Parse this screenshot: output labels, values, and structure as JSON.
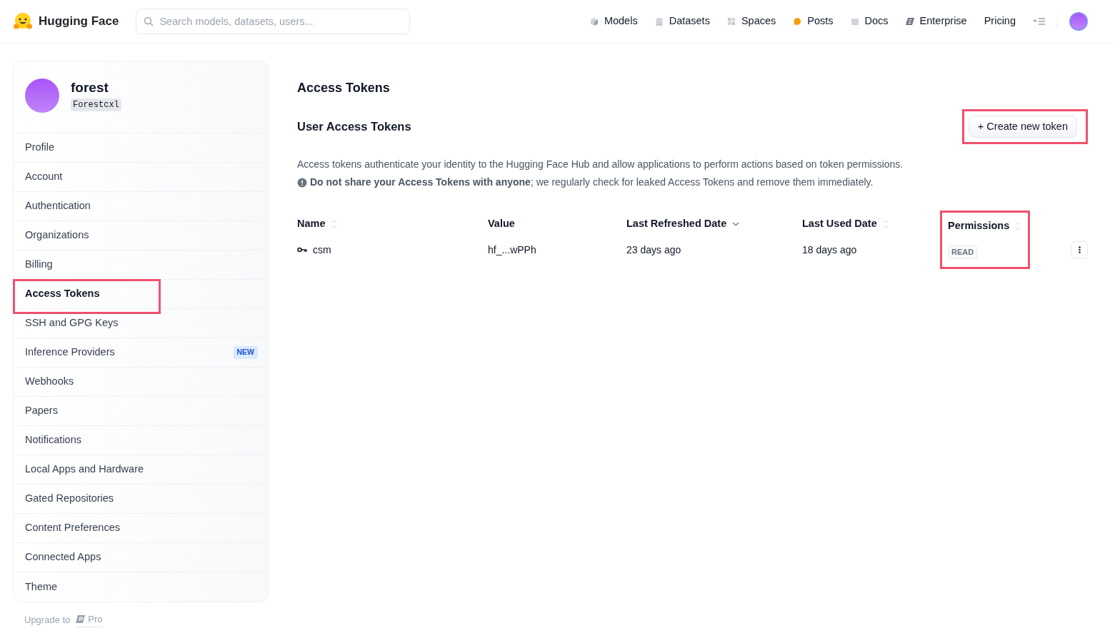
{
  "header": {
    "brand": "Hugging Face",
    "search": {
      "placeholder": "Search models, datasets, users..."
    },
    "nav": [
      {
        "label": "Models"
      },
      {
        "label": "Datasets"
      },
      {
        "label": "Spaces"
      },
      {
        "label": "Posts"
      },
      {
        "label": "Docs"
      },
      {
        "label": "Enterprise"
      },
      {
        "label": "Pricing"
      }
    ]
  },
  "profile": {
    "name": "forest",
    "username": "Forestcxl"
  },
  "sidebar": {
    "items": [
      {
        "label": "Profile",
        "selected": false,
        "highlighted": false
      },
      {
        "label": "Account",
        "selected": false,
        "highlighted": false
      },
      {
        "label": "Authentication",
        "selected": false,
        "highlighted": false
      },
      {
        "label": "Organizations",
        "selected": false,
        "highlighted": false
      },
      {
        "label": "Billing",
        "selected": false,
        "highlighted": false
      },
      {
        "label": "Access Tokens",
        "selected": true,
        "highlighted": true
      },
      {
        "label": "SSH and GPG Keys",
        "selected": false,
        "highlighted": false
      },
      {
        "label": "Inference Providers",
        "selected": false,
        "highlighted": false,
        "badge": "NEW"
      },
      {
        "label": "Webhooks",
        "selected": false,
        "highlighted": false
      },
      {
        "label": "Papers",
        "selected": false,
        "highlighted": false
      },
      {
        "label": "Notifications",
        "selected": false,
        "highlighted": false
      },
      {
        "label": "Local Apps and Hardware",
        "selected": false,
        "highlighted": false
      },
      {
        "label": "Gated Repositories",
        "selected": false,
        "highlighted": false
      },
      {
        "label": "Content Preferences",
        "selected": false,
        "highlighted": false
      },
      {
        "label": "Connected Apps",
        "selected": false,
        "highlighted": false
      },
      {
        "label": "Theme",
        "selected": false,
        "highlighted": false
      }
    ],
    "upgrade": {
      "label": "Upgrade to",
      "link": "Pro"
    }
  },
  "main": {
    "title": "Access Tokens",
    "section_title": "User Access Tokens",
    "create_button": {
      "label": "+ Create new token",
      "highlighted": true
    },
    "description": "Access tokens authenticate your identity to the Hugging Face Hub and allow applications to perform actions based on token permissions.",
    "warning": "**Do not share your Access Tokens with anyone**; we regularly check for leaked Access Tokens and remove them immediately.",
    "table": {
      "columns": [
        {
          "label": "Name",
          "sortable": true,
          "sorted": false,
          "highlighted": false
        },
        {
          "label": "Value",
          "sortable": false,
          "sorted": false,
          "highlighted": false
        },
        {
          "label": "Last Refreshed Date",
          "sortable": true,
          "sorted": true,
          "highlighted": false
        },
        {
          "label": "Last Used Date",
          "sortable": true,
          "sorted": false,
          "highlighted": false
        },
        {
          "label": "Permissions",
          "sortable": true,
          "sorted": false,
          "highlighted": true
        }
      ],
      "rows": [
        {
          "name": "csm",
          "value": "hf_...wPPh",
          "last_refreshed": "23 days ago",
          "last_used": "18 days ago",
          "permission": "READ"
        }
      ]
    }
  }
}
